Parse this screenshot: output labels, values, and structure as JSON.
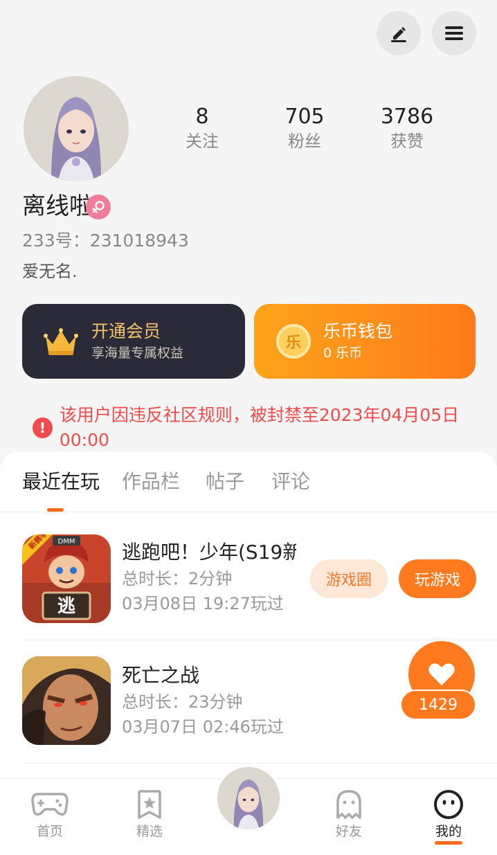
{
  "header": {
    "edit_icon": "pencil-icon",
    "menu_icon": "hamburger-menu-icon"
  },
  "profile": {
    "username": "离线啦",
    "gender_icon": "female-icon",
    "uid_text": "233号：231018943",
    "bio": "爱无名.",
    "stats": [
      {
        "value": "8",
        "label": "关注"
      },
      {
        "value": "705",
        "label": "粉丝"
      },
      {
        "value": "3786",
        "label": "获赞"
      }
    ]
  },
  "cards": {
    "vip": {
      "title": "开通会员",
      "subtitle": "享海量专属权益",
      "icon": "crown-icon"
    },
    "wallet": {
      "title": "乐币钱包",
      "subtitle": "0 乐币",
      "icon": "coin-icon",
      "coin_glyph": "乐"
    }
  },
  "ban_notice": {
    "icon": "warning-icon",
    "mark": "!",
    "text": "该用户因违反社区规则，被封禁至2023年04月05日 00:00"
  },
  "tabs": [
    {
      "label": "最近在玩",
      "active": true
    },
    {
      "label": "作品栏",
      "active": false
    },
    {
      "label": "帖子",
      "active": false
    },
    {
      "label": "评论",
      "active": false
    }
  ],
  "games": [
    {
      "title": "逃跑吧！少年(S19新…",
      "duration": "总时长：2分钟",
      "last_played": "03月08日 19:27玩过",
      "icon_badge": "新赛季",
      "icon_tag": "逃",
      "icon_brand": "DMM"
    },
    {
      "title": "死亡之战",
      "duration": "总时长：23分钟",
      "last_played": "03月07日 02:46玩过"
    }
  ],
  "game_actions": {
    "circle_label": "游戏圈",
    "play_label": "玩游戏"
  },
  "like_widget": {
    "icon": "heart-icon",
    "count": "1429"
  },
  "nav": [
    {
      "label": "首页",
      "icon": "gamepad-icon"
    },
    {
      "label": "精选",
      "icon": "star-bookmark-icon"
    },
    {
      "label": "好友",
      "icon": "ghost-icon"
    },
    {
      "label": "我的",
      "icon": "smiley-face-icon",
      "active": true
    }
  ],
  "colors": {
    "accent": "#ff7a1f",
    "warning": "#f04b4b",
    "vip_dark": "#2b2a38",
    "vip_gold": "#f4c46b"
  }
}
